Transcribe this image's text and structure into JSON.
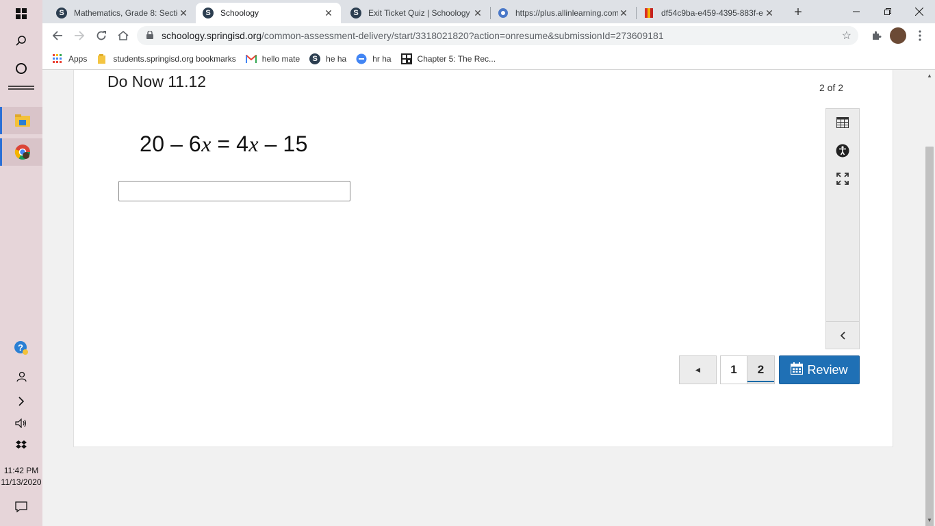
{
  "taskbar": {
    "time": "11:42 PM",
    "date": "11/13/2020"
  },
  "tabs": [
    {
      "title": "Mathematics, Grade 8: Sectio"
    },
    {
      "title": "Schoology"
    },
    {
      "title": "Exit Ticket Quiz | Schoology"
    },
    {
      "title": "https://plus.allinlearning.com"
    },
    {
      "title": "df54c9ba-e459-4395-883f-e"
    }
  ],
  "address": {
    "host": "schoology.springisd.org",
    "path": "/common-assessment-delivery/start/3318021820?action=onresume&submissionId=273609181"
  },
  "bookmarks": [
    {
      "label": "Apps"
    },
    {
      "label": "students.springisd.org bookmarks"
    },
    {
      "label": "hello mate"
    },
    {
      "label": "he ha"
    },
    {
      "label": "hr ha"
    },
    {
      "label": "Chapter 5: The Rec..."
    }
  ],
  "assessment": {
    "title": "Do Now 11.12",
    "count": "2 of 2",
    "equation": {
      "left_num": "20",
      "minus1": "–",
      "coef1": "6",
      "var1": "x",
      "equals": "=",
      "coef2": "4",
      "var2": "x",
      "minus2": "–",
      "right_num": "15"
    },
    "answer_value": ""
  },
  "pager": {
    "prev": "◄",
    "page1": "1",
    "page2": "2",
    "review": "Review"
  }
}
